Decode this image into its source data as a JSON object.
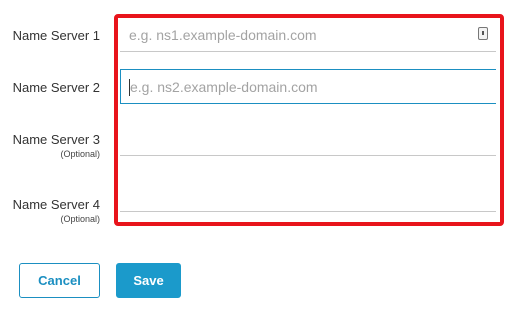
{
  "form": {
    "name_servers": [
      {
        "label": "Name Server 1",
        "optional_note": "",
        "placeholder": "e.g. ns1.example-domain.com",
        "value": ""
      },
      {
        "label": "Name Server 2",
        "optional_note": "",
        "placeholder": "e.g. ns2.example-domain.com",
        "value": ""
      },
      {
        "label": "Name Server 3",
        "optional_note": "(Optional)",
        "placeholder": "",
        "value": ""
      },
      {
        "label": "Name Server 4",
        "optional_note": "(Optional)",
        "placeholder": "",
        "value": ""
      }
    ]
  },
  "actions": {
    "cancel_label": "Cancel",
    "save_label": "Save"
  },
  "colors": {
    "accent": "#1b9acb",
    "highlight": "#e8141b"
  },
  "icons": {
    "password_manager": "password-manager-icon"
  }
}
